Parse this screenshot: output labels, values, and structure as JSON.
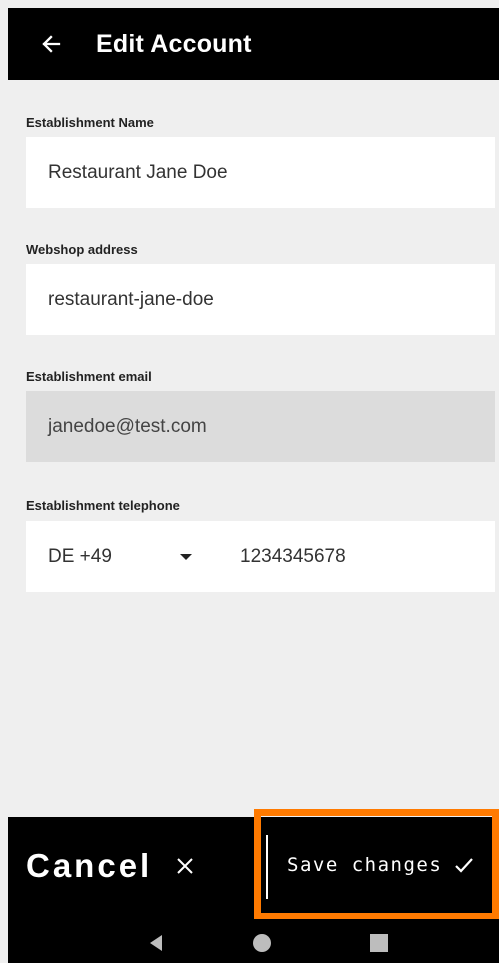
{
  "app": {
    "title": "Edit Account"
  },
  "form": {
    "establishment_name": {
      "label": "Establishment Name",
      "value": "Restaurant Jane Doe"
    },
    "webshop_address": {
      "label": "Webshop address",
      "value": "restaurant-jane-doe"
    },
    "establishment_email": {
      "label": "Establishment email",
      "value": "janedoe@test.com"
    },
    "establishment_telephone": {
      "label": "Establishment telephone",
      "country_code": "DE +49",
      "number": "1234345678"
    }
  },
  "actions": {
    "cancel_label": "Cancel",
    "save_label": "Save changes"
  },
  "colors": {
    "app_bar": "#000000",
    "background": "#efefef",
    "highlight": "#ff7a00"
  },
  "icons": {
    "back": "arrow-left-icon",
    "cancel": "close-icon",
    "save": "check-icon",
    "dropdown": "caret-down-icon"
  }
}
